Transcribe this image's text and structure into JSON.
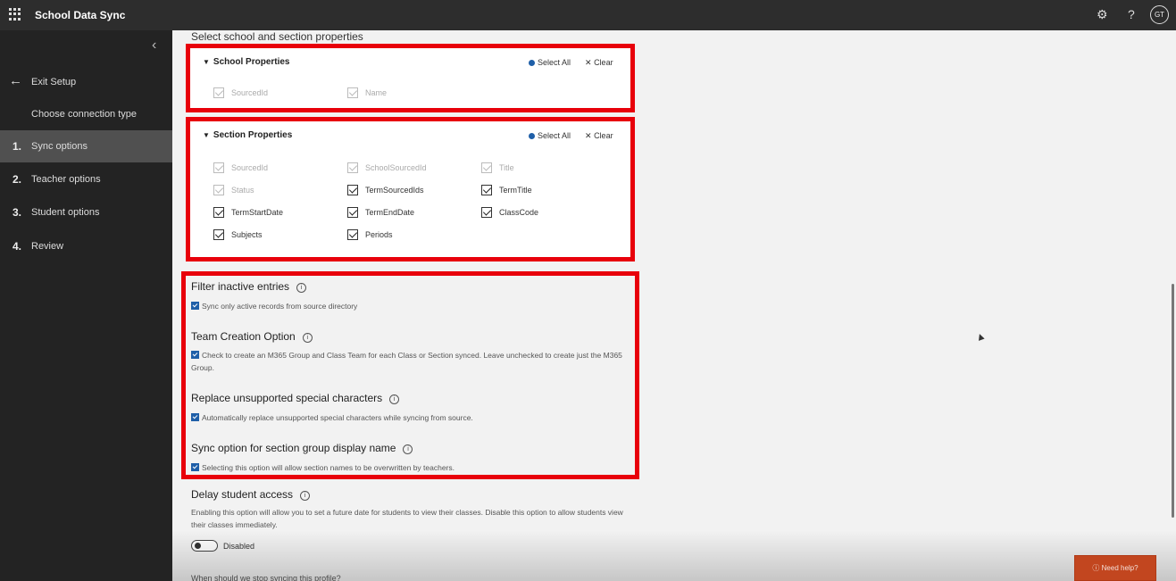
{
  "app": {
    "title": "School Data Sync"
  },
  "topbar": {
    "settings_icon": "gear-icon",
    "help_icon": "question-icon",
    "avatar_initials": "GT"
  },
  "sidebar": {
    "exit_label": "Exit Setup",
    "connection_label": "Choose connection type",
    "steps": [
      {
        "num": "1.",
        "label": "Sync options",
        "active": true
      },
      {
        "num": "2.",
        "label": "Teacher options",
        "active": false
      },
      {
        "num": "3.",
        "label": "Student options",
        "active": false
      },
      {
        "num": "4.",
        "label": "Review",
        "active": false
      }
    ]
  },
  "main": {
    "heading": "Select school and section properties",
    "school_card": {
      "title": "School Properties",
      "select_all": "Select All",
      "clear": "Clear",
      "fields": [
        {
          "label": "SourcedId",
          "checked": true,
          "disabled": true
        },
        {
          "label": "Name",
          "checked": true,
          "disabled": true
        }
      ]
    },
    "section_card": {
      "title": "Section Properties",
      "select_all": "Select All",
      "clear": "Clear",
      "fields": [
        {
          "label": "SourcedId",
          "checked": true,
          "disabled": true
        },
        {
          "label": "SchoolSourcedId",
          "checked": true,
          "disabled": true
        },
        {
          "label": "Title",
          "checked": true,
          "disabled": true
        },
        {
          "label": "Status",
          "checked": true,
          "disabled": true
        },
        {
          "label": "TermSourcedIds",
          "checked": true,
          "disabled": false
        },
        {
          "label": "TermTitle",
          "checked": true,
          "disabled": false
        },
        {
          "label": "TermStartDate",
          "checked": true,
          "disabled": false
        },
        {
          "label": "TermEndDate",
          "checked": true,
          "disabled": false
        },
        {
          "label": "ClassCode",
          "checked": true,
          "disabled": false
        },
        {
          "label": "Subjects",
          "checked": true,
          "disabled": false
        },
        {
          "label": "Periods",
          "checked": true,
          "disabled": false
        }
      ]
    },
    "options": [
      {
        "title": "Filter inactive entries",
        "description": "Sync only active records from source directory",
        "checked": true
      },
      {
        "title": "Team Creation Option",
        "description": "Check to create an M365 Group and Class Team for each Class or Section synced. Leave unchecked to create just the M365 Group.",
        "checked": true
      },
      {
        "title": "Replace unsupported special characters",
        "description": "Automatically replace unsupported special characters while syncing from source.",
        "checked": true
      },
      {
        "title": "Sync option for section group display name",
        "description": "Selecting this option will allow section names to be overwritten by teachers.",
        "checked": true
      }
    ],
    "delay": {
      "title": "Delay student access",
      "description": "Enabling this option will allow you to set a future date for students to view their classes. Disable this option to allow students view their classes immediately.",
      "toggle_label": "Disabled",
      "enabled": false
    },
    "next_question": "When should we stop syncing this profile?"
  },
  "help_button": {
    "label": "Need help?"
  },
  "colors": {
    "highlight": "#e8000b",
    "accent": "#1f5fa8",
    "help": "#c2461f"
  }
}
